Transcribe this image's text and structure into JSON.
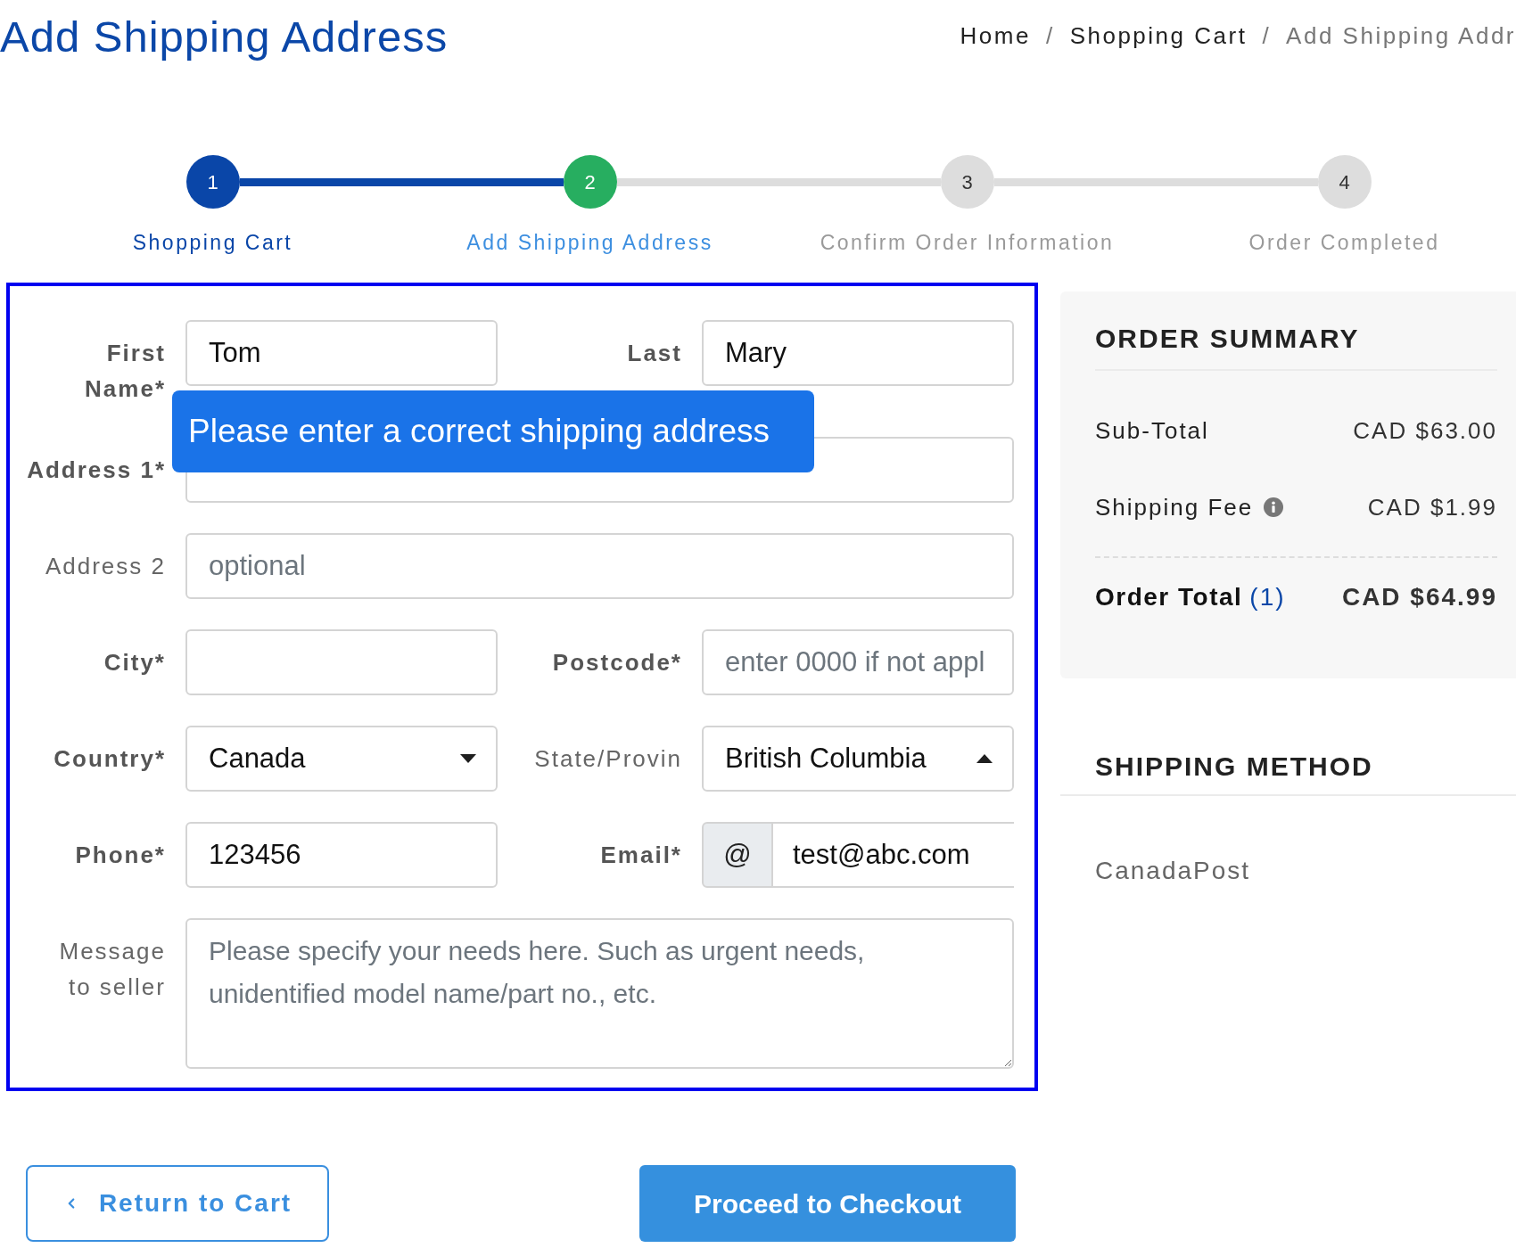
{
  "page": {
    "title": "Add Shipping Address"
  },
  "breadcrumb": {
    "items": [
      {
        "label": "Home",
        "current": false
      },
      {
        "label": "Shopping Cart",
        "current": false
      },
      {
        "label": "Add Shipping Addr",
        "current": true
      }
    ],
    "separators": [
      "/",
      "/"
    ]
  },
  "stepper": {
    "steps": [
      {
        "number": "1",
        "label": "Shopping Cart",
        "completed": true,
        "selected": false
      },
      {
        "number": "2",
        "label": "Add Shipping Address",
        "completed": false,
        "selected": true
      },
      {
        "number": "3",
        "label": "Confirm Order Information",
        "completed": false,
        "selected": false
      },
      {
        "number": "4",
        "label": "Order Completed",
        "completed": false,
        "selected": false
      }
    ]
  },
  "form": {
    "rows": [
      {
        "fields": [
          {
            "kind": "text",
            "label": "First Name*",
            "required": true,
            "value": "Tom"
          },
          {
            "kind": "text",
            "label": "Last",
            "required": true,
            "value": "Mary"
          }
        ]
      },
      {
        "fields": [
          {
            "kind": "text",
            "label": "Address 1*",
            "required": true
          }
        ]
      },
      {
        "fields": [
          {
            "kind": "text",
            "label": "Address 2",
            "required": false,
            "placeholder": "optional"
          }
        ]
      },
      {
        "fields": [
          {
            "kind": "text",
            "label": "City*",
            "required": true
          },
          {
            "kind": "text",
            "label": "Postcode*",
            "required": true,
            "placeholder": "enter 0000 if not appl"
          }
        ]
      },
      {
        "fields": [
          {
            "kind": "select",
            "label": "Country*",
            "required": true,
            "value": "Canada",
            "expanded": false
          },
          {
            "kind": "select",
            "label": "State/Provin",
            "required": false,
            "value": "British Columbia",
            "expanded": true
          }
        ]
      },
      {
        "fields": [
          {
            "kind": "text",
            "label": "Phone*",
            "required": true,
            "value": "123456"
          },
          {
            "kind": "email",
            "label": "Email*",
            "required": true,
            "addon": "@",
            "value": "test@abc.com"
          }
        ]
      },
      {
        "fields": [
          {
            "kind": "textarea",
            "label": "Message to seller",
            "required": false,
            "placeholder": "Please specify your needs here. Such as urgent needs, unidentified model name/part no., etc."
          }
        ]
      }
    ],
    "tooltip": {
      "text": "Please enter a correct shipping address"
    }
  },
  "order_summary": {
    "title": "ORDER SUMMARY",
    "rows": [
      {
        "kind": "line",
        "label": "Sub-Total",
        "info": false,
        "value": "CAD $63.00"
      },
      {
        "kind": "line",
        "label": "Shipping Fee",
        "info": true,
        "value": "CAD $1.99"
      },
      {
        "kind": "total",
        "label": "Order Total",
        "count": "(1)",
        "value": "CAD $64.99"
      }
    ]
  },
  "shipping_method": {
    "title": "SHIPPING METHOD",
    "option": "CanadaPost"
  },
  "actions": [
    {
      "kind": "back",
      "label": "Return to Cart"
    },
    {
      "kind": "primary",
      "label": "Proceed to Checkout"
    }
  ]
}
